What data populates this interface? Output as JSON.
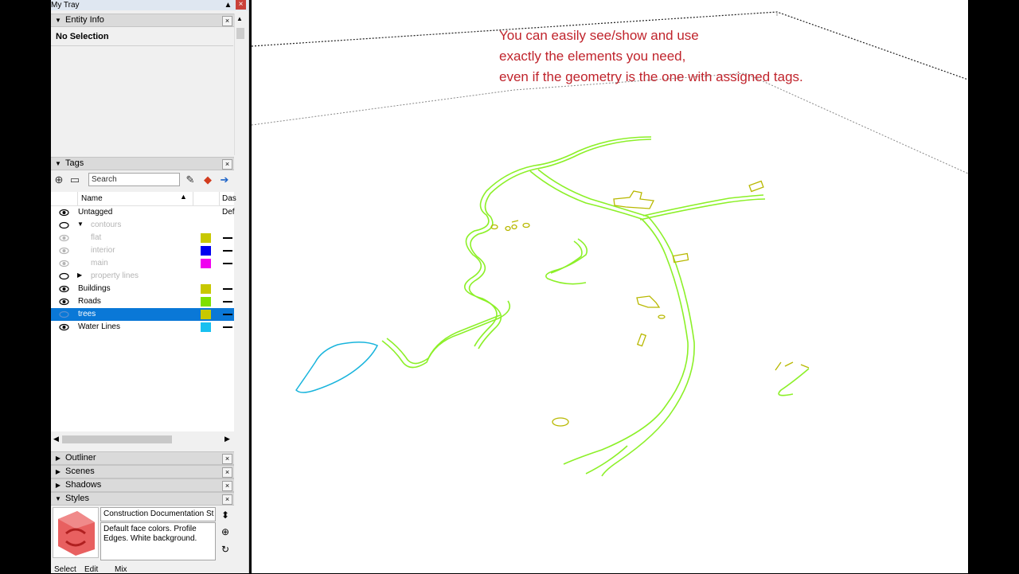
{
  "tray": {
    "title": "My Tray",
    "pin": "▲",
    "close": "×"
  },
  "entity_info": {
    "title": "Entity Info",
    "status": "No Selection"
  },
  "tags": {
    "title": "Tags",
    "search_placeholder": "Search",
    "col_name": "Name",
    "col_dashes": "Das",
    "rows": [
      {
        "label": "Untagged",
        "dash_text": "Def",
        "indent": 0,
        "eye": "open",
        "dim": false
      },
      {
        "label": "contours",
        "indent": 1,
        "arrow": "▼",
        "eye": "closed",
        "dim": true
      },
      {
        "label": "flat",
        "indent": 2,
        "color": "#c8c800",
        "eye": "open",
        "dim": true
      },
      {
        "label": "interior",
        "indent": 2,
        "color": "#0000f0",
        "eye": "open",
        "dim": true
      },
      {
        "label": "main",
        "indent": 2,
        "color": "#f000f0",
        "eye": "open",
        "dim": true
      },
      {
        "label": "property lines",
        "indent": 1,
        "arrow": "▶",
        "eye": "closed",
        "dim": true
      },
      {
        "label": "Buildings",
        "indent": 0,
        "color": "#c8c800",
        "eye": "open",
        "dim": false
      },
      {
        "label": "Roads",
        "indent": 0,
        "color": "#7fe000",
        "eye": "open",
        "dim": false
      },
      {
        "label": "trees",
        "indent": 0,
        "color": "#c8c800",
        "eye": "closed",
        "dim": false,
        "selected": true
      },
      {
        "label": "Water Lines",
        "indent": 0,
        "color": "#18c0f0",
        "eye": "open",
        "dim": false
      }
    ]
  },
  "panels": {
    "outliner": "Outliner",
    "scenes": "Scenes",
    "shadows": "Shadows",
    "styles": "Styles"
  },
  "styles": {
    "name": "Construction Documentation St",
    "description": "Default face colors. Profile Edges. White background.",
    "tabs": [
      "Select",
      "Edit",
      "Mix"
    ]
  },
  "annotation": {
    "line1": "You can easily see/show and use",
    "line2": "exactly the elements you need,",
    "line3": "even if the geometry is the one with assigned tags."
  },
  "colors": {
    "accent_selected": "#0a78d7",
    "annotation": "#c0242c",
    "roads": "#8cf028",
    "buildings": "#c8c800",
    "water": "#18b4dc"
  }
}
